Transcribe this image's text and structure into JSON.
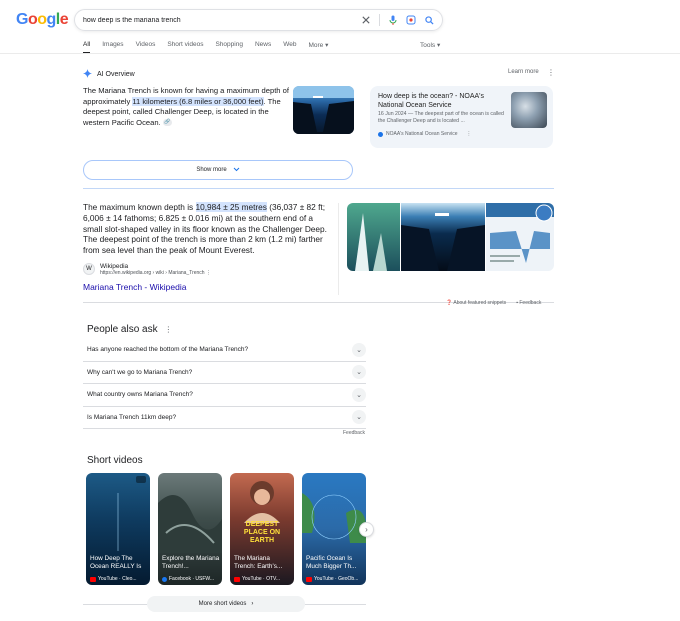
{
  "logo": [
    "G",
    "o",
    "o",
    "g",
    "l",
    "e"
  ],
  "search": {
    "query": "how deep is the mariana trench"
  },
  "tabs": [
    "All",
    "Images",
    "Videos",
    "Short videos",
    "Shopping",
    "News",
    "Web",
    "More"
  ],
  "tools_label": "Tools",
  "ai_overview": {
    "label": "AI Overview",
    "learn_more": "Learn more",
    "text_pre": "The Mariana Trench is known for having a maximum depth of approximately ",
    "text_highlight": "11 kilometers (6.8 miles or 36,000 feet)",
    "text_post": ". The deepest point, called Challenger Deep, is located in the western Pacific Ocean.",
    "card": {
      "title": "How deep is the ocean? - NOAA's National Ocean Service",
      "snippet": "16 Jun 2024 — The deepest part of the ocean is called the Challenger Deep and is located ...",
      "source": "NOAA's National Ocean Service"
    },
    "show_more": "Show more"
  },
  "featured_snippet": {
    "text_pre": "The maximum known depth is ",
    "text_highlight": "10,984 ± 25 metres",
    "text_post": " (36,037 ± 82 ft; 6,006 ± 14 fathoms; 6.825 ± 0.016 mi) at the southern end of a small slot-shaped valley in its floor known as the Challenger Deep. The deepest point of the trench is more than 2 km (1.2 mi) farther from sea level than the peak of Mount Everest.",
    "source_name": "Wikipedia",
    "source_url": "https://en.wikipedia.org › wiki › Mariana_Trench",
    "link_title": "Mariana Trench - Wikipedia",
    "about_label": "About featured snippets",
    "feedback_label": "Feedback"
  },
  "paa": {
    "title": "People also ask",
    "questions": [
      "Has anyone reached the bottom of the Mariana Trench?",
      "Why can't we go to Mariana Trench?",
      "What country owns Mariana Trench?",
      "Is Mariana Trench 11km deep?"
    ],
    "feedback": "Feedback"
  },
  "short_videos": {
    "title": "Short videos",
    "items": [
      {
        "caption": "How Deep The Ocean REALLY Is",
        "source": "YouTube · Cleo...",
        "platform": "youtube"
      },
      {
        "caption": "Explore the Mariana Trench!...",
        "source": "Facebook · USFW...",
        "platform": "facebook"
      },
      {
        "caption": "The Mariana Trench: Earth's...",
        "source": "YouTube · OTV...",
        "platform": "youtube",
        "overlay": "DEEPEST PLACE ON EARTH"
      },
      {
        "caption": "Pacific Ocean Is Much Bigger Th...",
        "source": "YouTube · GeoOb...",
        "platform": "youtube"
      }
    ],
    "more_label": "More short videos"
  }
}
